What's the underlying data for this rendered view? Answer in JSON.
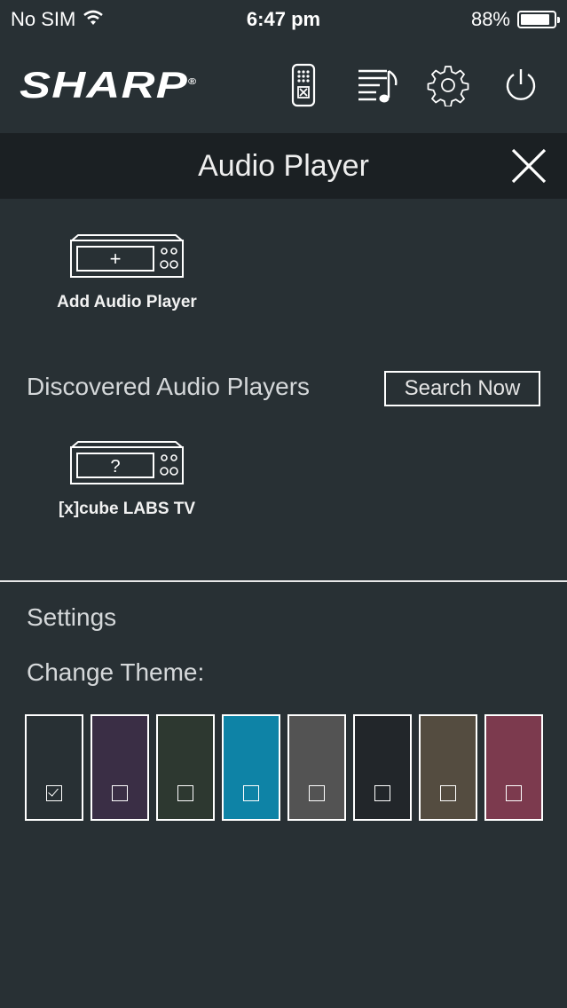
{
  "status_bar": {
    "carrier": "No SIM",
    "time": "6:47 pm",
    "battery": "88%",
    "battery_level": 0.88
  },
  "header": {
    "logo": "SHARP",
    "icons": [
      "remote-icon",
      "playlist-music-icon",
      "gear-icon",
      "power-icon"
    ]
  },
  "panel": {
    "title": "Audio Player"
  },
  "add_player": {
    "label": "Add Audio Player",
    "glyph": "+"
  },
  "discovered": {
    "title": "Discovered Audio Players",
    "search_label": "Search Now",
    "devices": [
      {
        "label": "[x]cube LABS TV",
        "glyph": "?"
      }
    ]
  },
  "settings": {
    "title": "Settings",
    "theme_label": "Change Theme:",
    "themes": [
      {
        "color": "#283034",
        "selected": true
      },
      {
        "color": "#3a2e45",
        "selected": false
      },
      {
        "color": "#2d3830",
        "selected": false
      },
      {
        "color": "#0e83a6",
        "selected": false
      },
      {
        "color": "#535353",
        "selected": false
      },
      {
        "color": "#22262a",
        "selected": false
      },
      {
        "color": "#544c40",
        "selected": false
      },
      {
        "color": "#7c3a4e",
        "selected": false
      }
    ]
  }
}
